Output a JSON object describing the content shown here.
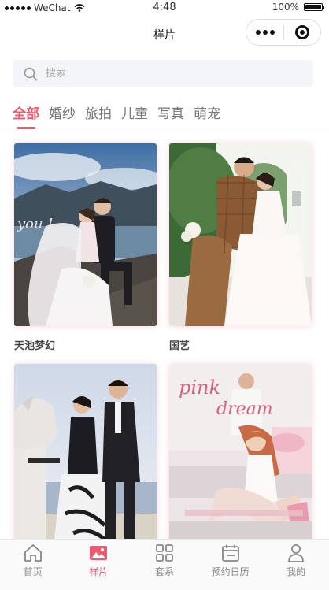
{
  "status_bar": {
    "carrier": "WeChat",
    "time": "4:48",
    "battery": "100%"
  },
  "navbar": {
    "title": "样片"
  },
  "search": {
    "placeholder": "搜索"
  },
  "tabs": [
    {
      "label": "全部",
      "active": true
    },
    {
      "label": "婚纱"
    },
    {
      "label": "旅拍"
    },
    {
      "label": "儿童"
    },
    {
      "label": "写真"
    },
    {
      "label": "萌宠"
    }
  ],
  "cards": [
    {
      "title": "天池梦幻"
    },
    {
      "title": "国艺"
    },
    {
      "title": ""
    },
    {
      "photo_text": "pink dream",
      "title": ""
    }
  ],
  "tabbar": [
    {
      "label": "首页",
      "icon": "home-icon"
    },
    {
      "label": "样片",
      "icon": "gallery-icon",
      "active": true
    },
    {
      "label": "套系",
      "icon": "grid-icon"
    },
    {
      "label": "预约日历",
      "icon": "calendar-icon"
    },
    {
      "label": "我的",
      "icon": "user-icon"
    }
  ],
  "colors": {
    "accent": "#f05a6e",
    "search_bg": "#f4f5f8"
  }
}
